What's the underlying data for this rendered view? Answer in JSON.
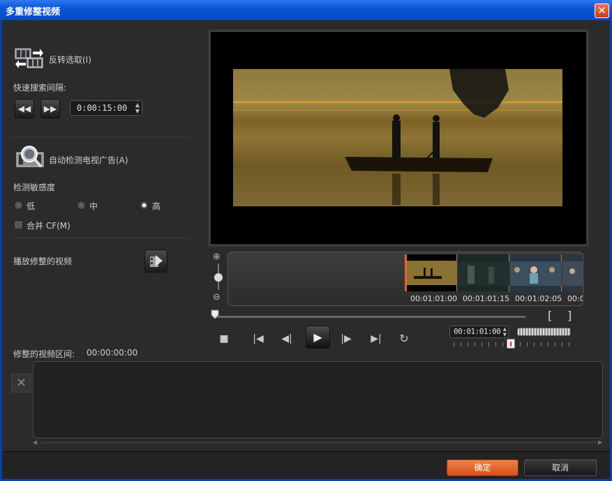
{
  "window": {
    "title": "多重修整视频",
    "close_label": "✕"
  },
  "left_panel": {
    "invert_selection_label": "反转选取(I)",
    "quick_search_label": "快速搜索间隔:",
    "interval_value": "0:00:15:00",
    "rewind_label": "◀◀",
    "forward_label": "▶▶",
    "detect_ads_label": "自动检测电视广告(A)",
    "sensitivity_label": "检测敏感度",
    "sens_low": "低",
    "sens_mid": "中",
    "sens_high": "高",
    "merge_label": "合并 CF(M)",
    "play_trimmed_label": "播放修整的视频"
  },
  "timeline": {
    "timecodes": [
      "00:01:01:00",
      "00:01:01:15",
      "00:01:02:05",
      "00:0"
    ]
  },
  "transport": {
    "current_time": "00:01:01:00",
    "mark_in": "[",
    "mark_out": "]"
  },
  "trim": {
    "interval_label": "修整的视频区间:",
    "interval_value": "00:00:00:00"
  },
  "footer": {
    "ok": "确定",
    "cancel": "取消"
  }
}
